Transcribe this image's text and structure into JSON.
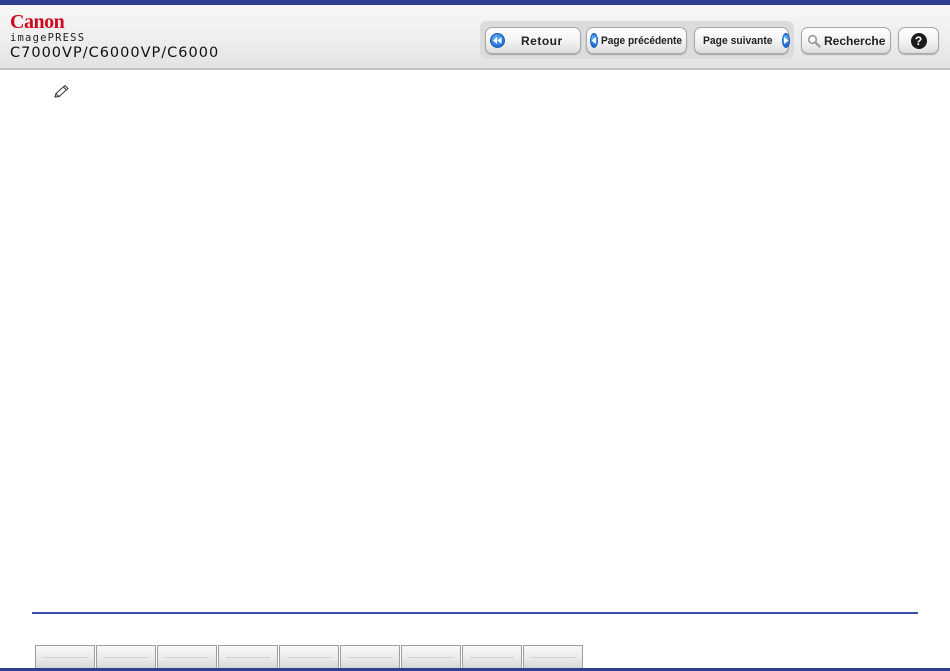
{
  "header": {
    "logo": "Canon",
    "brand": "imagePRESS",
    "model": "C7000VP/C6000VP/C6000"
  },
  "nav": {
    "retour": "Retour",
    "prev": "Page précédente",
    "next": "Page suivante",
    "search": "Recherche",
    "help": "?"
  },
  "icons": {
    "retour": "double-back-arrow-icon",
    "prev": "back-arrow-icon",
    "next": "forward-arrow-icon",
    "search": "magnifier-icon",
    "help": "question-icon",
    "note": "pencil-icon"
  },
  "colors": {
    "accent": "#2f3f8f",
    "logo": "#cc0a1e",
    "nav_icon": "#1e6fd6"
  },
  "footer": {
    "tabs": [
      "",
      "",
      "",
      "",
      "",
      "",
      "",
      "",
      ""
    ]
  }
}
